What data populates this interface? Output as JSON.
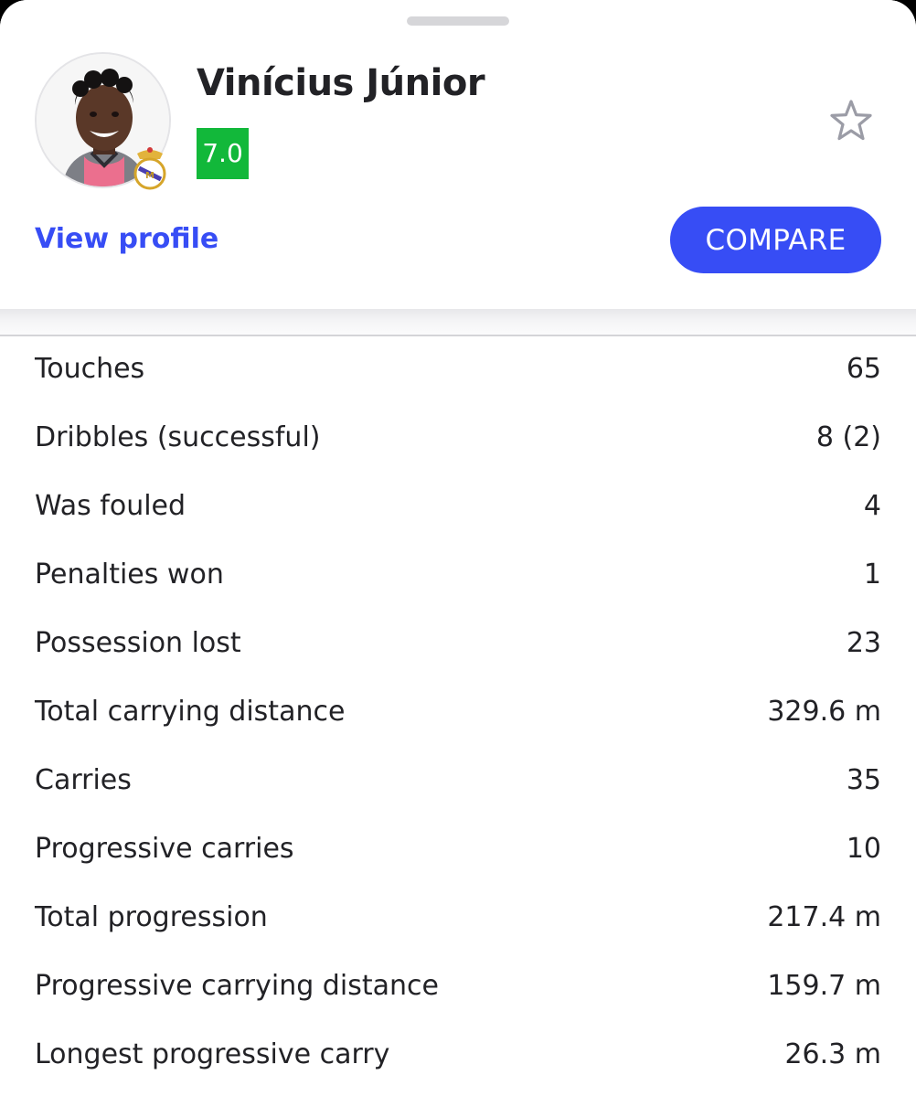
{
  "player": {
    "name": "Vinícius Júnior",
    "rating": "7.0",
    "avatar_icon": "player-photo",
    "club_icon": "real-madrid-crest",
    "favorite_icon": "star-outline-icon"
  },
  "actions": {
    "view_profile_label": "View profile",
    "compare_label": "COMPARE"
  },
  "colors": {
    "accent": "#374df5",
    "rating": "#12b83a"
  },
  "stats": [
    {
      "label": "Touches",
      "value": "65"
    },
    {
      "label": "Dribbles (successful)",
      "value": "8 (2)"
    },
    {
      "label": "Was fouled",
      "value": "4"
    },
    {
      "label": "Penalties won",
      "value": "1"
    },
    {
      "label": "Possession lost",
      "value": "23"
    },
    {
      "label": "Total carrying distance",
      "value": "329.6 m"
    },
    {
      "label": "Carries",
      "value": "35"
    },
    {
      "label": "Progressive carries",
      "value": "10"
    },
    {
      "label": "Total progression",
      "value": "217.4 m"
    },
    {
      "label": "Progressive carrying distance",
      "value": "159.7 m"
    },
    {
      "label": "Longest progressive carry",
      "value": "26.3 m"
    }
  ]
}
